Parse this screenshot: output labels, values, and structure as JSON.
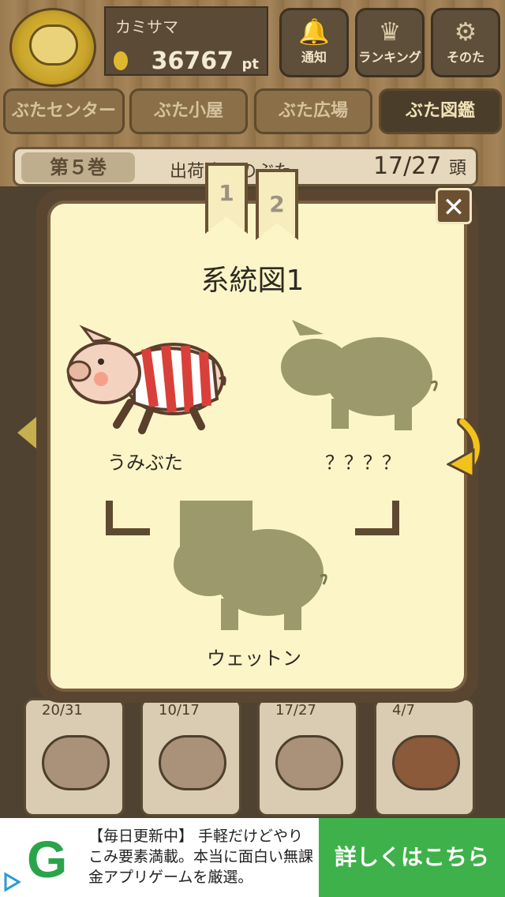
{
  "header": {
    "player_name": "カミサマ",
    "points": "36767",
    "points_unit": "pt",
    "buttons": [
      {
        "label": "通知",
        "icon": "bell-icon"
      },
      {
        "label": "ランキング",
        "icon": "crown-icon"
      },
      {
        "label": "そのた",
        "icon": "gear-icon"
      }
    ]
  },
  "tabs": [
    {
      "label": "ぶたセンター"
    },
    {
      "label": "ぶた小屋"
    },
    {
      "label": "ぶた広場"
    },
    {
      "label": "ぶた図鑑"
    }
  ],
  "book": {
    "volume": "第５巻",
    "subtitle": "出荷済みのぶた",
    "count": "17/27",
    "count_unit": "頭"
  },
  "dialog": {
    "pages": [
      "1",
      "2"
    ],
    "title": "系統図1",
    "parent_left": "うみぶた",
    "parent_right": "？？？？",
    "child": "ウェットン",
    "close_label": "✕"
  },
  "cards": [
    {
      "count": "20/31"
    },
    {
      "count": "10/17"
    },
    {
      "count": "17/27"
    },
    {
      "count": "4/7"
    }
  ],
  "ad": {
    "logo": "G",
    "text": "【毎日更新中】 手軽だけどやりこみ要素満載。本当に面白い無課金アプリゲームを厳選。",
    "cta": "詳しくはこちら"
  },
  "colors": {
    "accent": "#3fb14a",
    "dialog_bg": "#fcf5c8",
    "silhouette": "#9a9a6a"
  }
}
